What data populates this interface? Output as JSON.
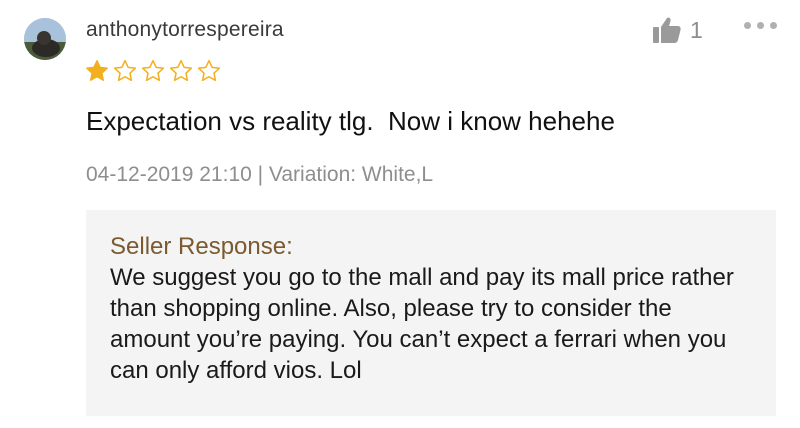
{
  "review": {
    "username": "anthonytorrespereira",
    "rating": 1,
    "max_rating": 5,
    "comment": "Expectation vs reality tlg.  Now i know hehehe",
    "meta": "04-12-2019 21:10 | Variation: White,L",
    "likes": "1"
  },
  "seller_response": {
    "title": "Seller Response:",
    "body": "We suggest you go to the mall and pay its mall price rather than shopping online. Also, please try to consider the amount you’re paying. You can’t expect a ferrari when you can only afford vios. Lol"
  },
  "icons": {
    "like": "thumbs-up-icon",
    "more": "more-options-icon",
    "star_filled": "star-filled-icon",
    "star_empty": "star-empty-icon"
  },
  "colors": {
    "star": "#f2b01e",
    "seller_title": "#7a5a2e",
    "muted": "#8e8e8e",
    "response_bg": "#f4f4f4"
  }
}
